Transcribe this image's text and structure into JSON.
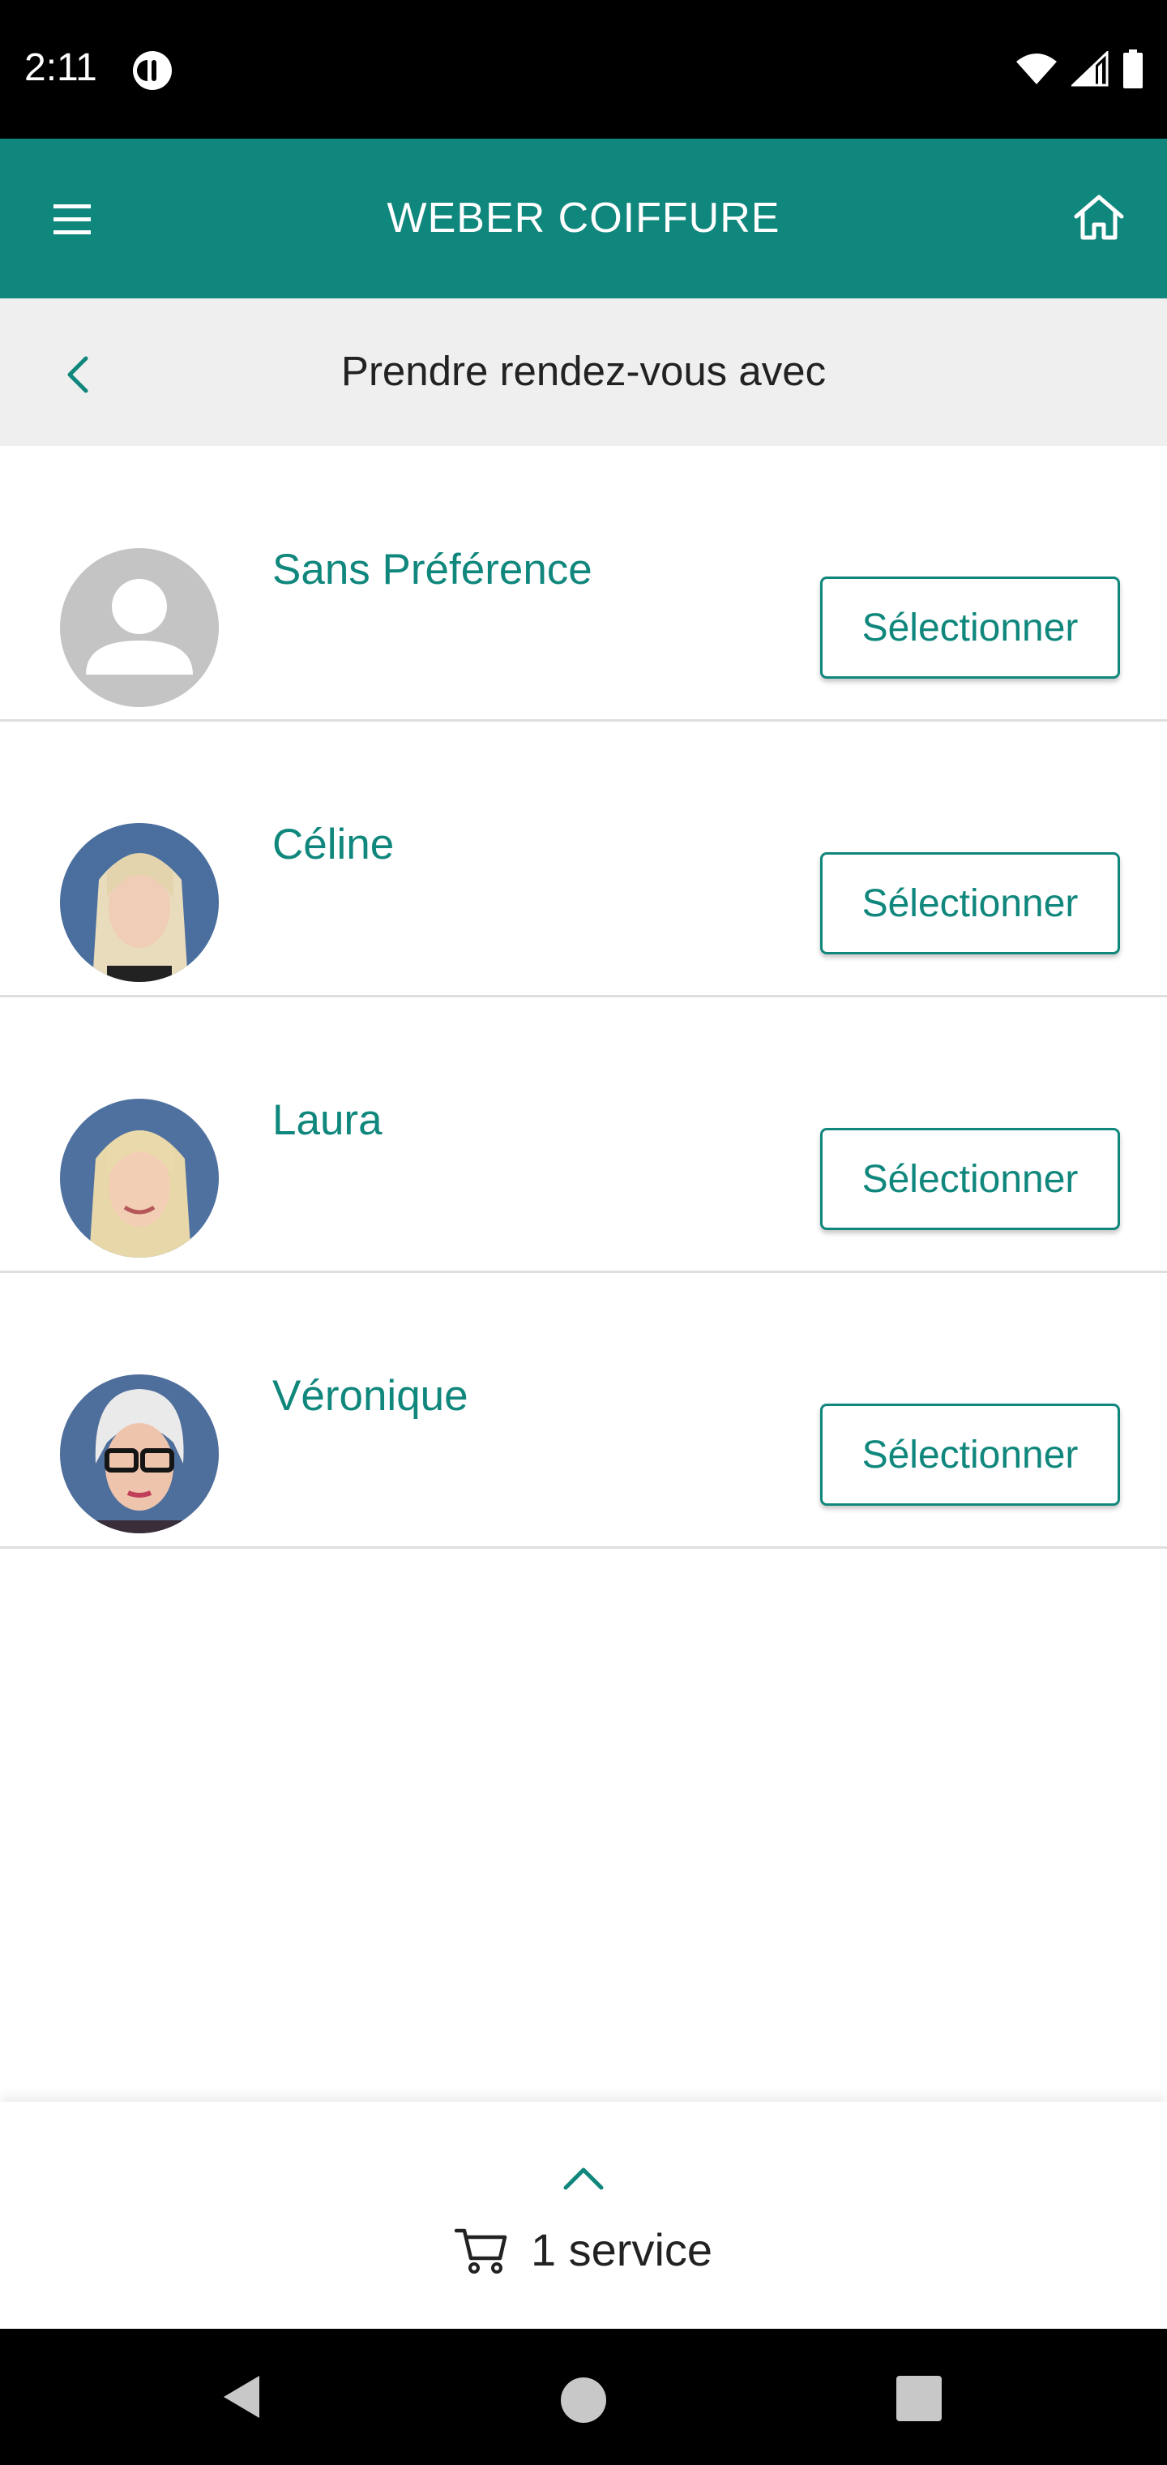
{
  "status_bar": {
    "time": "2:11",
    "icons": [
      "wifi-icon",
      "signal-icon",
      "battery-icon"
    ]
  },
  "app_bar": {
    "title": "WEBER COIFFURE",
    "menu_icon": "hamburger-menu-icon",
    "home_icon": "home-icon",
    "background": "#10877c"
  },
  "sub_header": {
    "title": "Prendre rendez-vous avec",
    "back_icon": "chevron-left-icon"
  },
  "staff": [
    {
      "name": "Sans Préférence",
      "button": "Sélectionner",
      "avatar": "default-person-avatar"
    },
    {
      "name": "Céline",
      "button": "Sélectionner",
      "avatar": "photo-avatar"
    },
    {
      "name": "Laura",
      "button": "Sélectionner",
      "avatar": "photo-avatar"
    },
    {
      "name": "Véronique",
      "button": "Sélectionner",
      "avatar": "photo-avatar"
    }
  ],
  "cart": {
    "label": "1 service",
    "expand_icon": "chevron-up-icon",
    "cart_icon": "shopping-cart-icon"
  },
  "colors": {
    "accent": "#10877c",
    "subheader_bg": "#efefef"
  }
}
